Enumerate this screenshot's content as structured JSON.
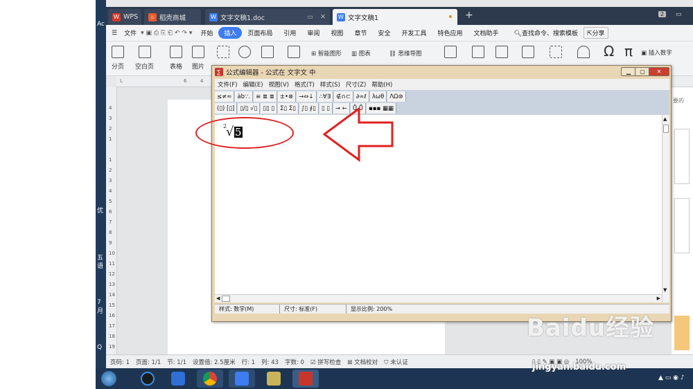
{
  "desktop": {
    "left_labels": [
      "Ac",
      "优",
      "五",
      "语",
      "7月",
      "Q"
    ]
  },
  "tabs": {
    "wps": "WPS",
    "shop": "稻壳商城",
    "doc1": "文字文稿1.doc",
    "doc2": "文字文稿1",
    "count": "2"
  },
  "menu": {
    "file": "文件",
    "items": [
      "开始",
      "插入",
      "页面布局",
      "引用",
      "审阅",
      "视图",
      "章节",
      "安全",
      "开发工具",
      "特色应用",
      "文档助手"
    ],
    "active": "插入",
    "search": "查找命令、搜索模板",
    "share": "分享"
  },
  "ribbon": {
    "fenye": "分页",
    "kongbai": "空白页",
    "biaoge": "表格",
    "tupian": "图片",
    "smart_shape": "智能图形",
    "chart": "图表",
    "mindmap": "思维导图",
    "insert_number": "插入数字",
    "side_text": "要的"
  },
  "ruler": {
    "h": [
      "6",
      "4"
    ],
    "v": [
      "4",
      "3",
      "2",
      "1",
      "1",
      "2",
      "3",
      "4",
      "5",
      "6",
      "7",
      "8",
      "9",
      "10",
      "11",
      "12",
      "13",
      "14",
      "15",
      "16",
      "17",
      "18",
      "19"
    ]
  },
  "eq": {
    "title": "公式编辑器 - 公式在 文字文 中",
    "menu": [
      "文件(F)",
      "编辑(E)",
      "视图(V)",
      "格式(T)",
      "样式(S)",
      "尺寸(Z)",
      "帮助(H)"
    ],
    "row1": [
      "≤≠≈",
      "ȧb∵.",
      "≡ ≣ ≣",
      "±•⊗",
      "→⇔↓",
      "∴∀∃",
      "∉∩⊂",
      "∂∞ℓ",
      "λωθ",
      "ΛΩ⊛"
    ],
    "row2": [
      "(▯) [▯]",
      "▯/▯ √▯",
      "▯▯ ▯",
      "Σ▯ Σ▯",
      "∫▯ ∮▯",
      "▯ ▯",
      "→ ←",
      "Ů Ů",
      "▪▪▪ ▦▦"
    ],
    "formula_index": "2",
    "formula_radicand": "5",
    "status": {
      "style": "样式: 数学(M)",
      "size": "尺寸: 标准(F)",
      "zoom": "显示比例: 200%"
    }
  },
  "status": {
    "items": [
      "页码: 1",
      "页面: 1/1",
      "节: 1/1",
      "设置值: 2.5厘米",
      "行: 1",
      "列: 43",
      "字数: 0"
    ],
    "spell": "拼写检查",
    "proof": "文档校对",
    "cert": "未认证",
    "zoom": "100%"
  },
  "watermark": {
    "brand": "Baidu经验",
    "url": "jingyan.baidu.com"
  },
  "colors": {
    "tabbar": "#2d3a4e",
    "accent": "#3d7cf1",
    "eq_window": "#e9d6b4",
    "annotation": "#e02020",
    "taskbar": "#1d3552"
  }
}
